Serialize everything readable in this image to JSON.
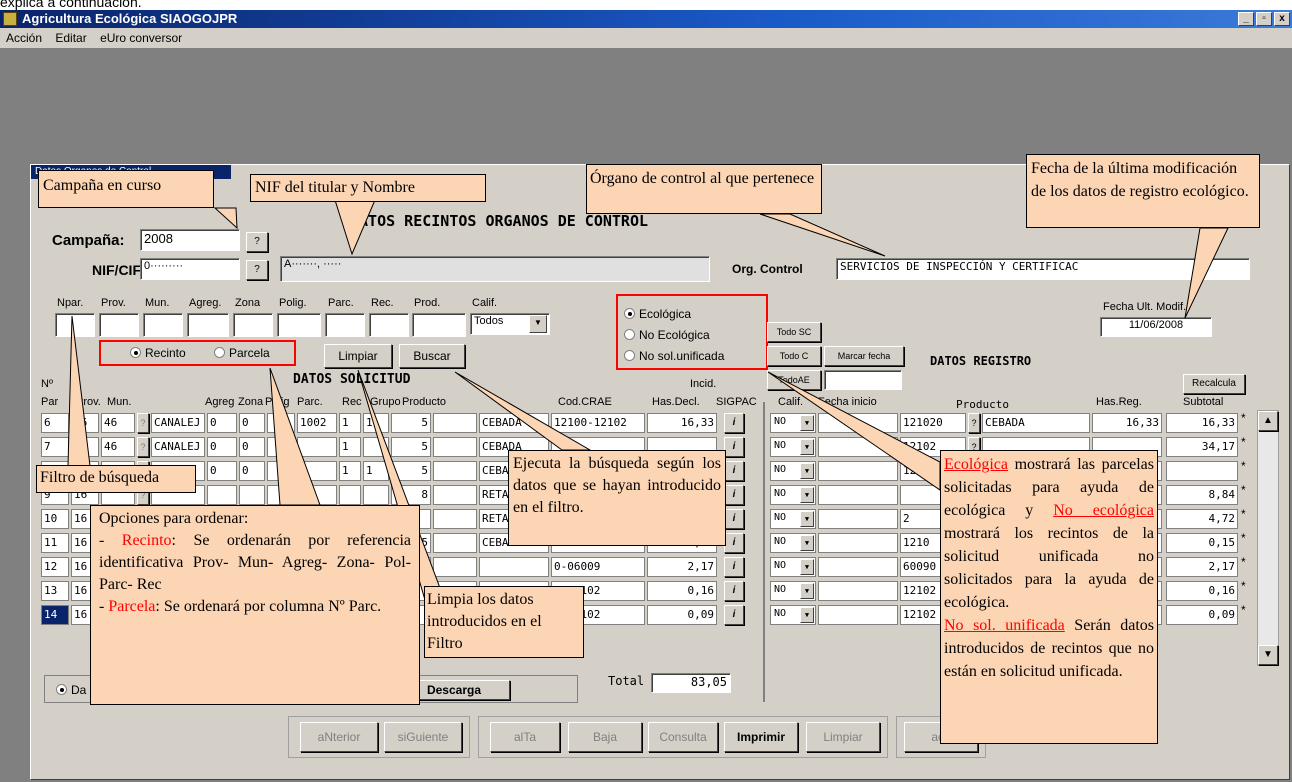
{
  "top_text": "explica a continuación.",
  "window": {
    "title": "Agricultura Ecológica   SIAOGOJPR",
    "min": "_",
    "max": "▫",
    "close": "x"
  },
  "menu": [
    "Acción",
    "Editar",
    "eUro conversor"
  ],
  "form_title": "Datos Organos de Control",
  "heading_recintos": "DATOS RECINTOS ORGANOS DE CONTROL",
  "campana": {
    "label": "Campaña:",
    "value": "2008",
    "q": "?"
  },
  "nif": {
    "label": "NIF/CIF:",
    "value": "0·········",
    "name": "A·······, ·····",
    "q": "?"
  },
  "org_control": {
    "label": "Org. Control",
    "value": "SERVICIOS DE INSPECCIÓN Y CERTIFICAC"
  },
  "filters": {
    "labels": [
      "Npar.",
      "Prov.",
      "Mun.",
      "Agreg.",
      "Zona",
      "Polig.",
      "Parc.",
      "Rec.",
      "Prod.",
      "Calif."
    ],
    "calif_value": "Todos"
  },
  "order": {
    "recinto": "Recinto",
    "parcela": "Parcela"
  },
  "buttons": {
    "limpiar": "Limpiar",
    "buscar": "Buscar",
    "todo_sc": "Todo SC",
    "todo_c": "Todo C",
    "marcar_fecha": "Marcar fecha",
    "todo_ae": "TodoAE",
    "recalcula": "Recalcula",
    "descarga": "Descarga",
    "q": "?",
    "i": "i"
  },
  "tipo": {
    "ecologica": "Ecológica",
    "no_ecologica": "No Ecológica",
    "no_sol": "No sol.unificada"
  },
  "fecha_ult": {
    "label": "Fecha Ult. Modif.",
    "value": "11/06/2008"
  },
  "heading_registro": "DATOS REGISTRO",
  "heading_solicitud": "DATOS SOLICITUD",
  "col_headers": {
    "n": "Nº",
    "par": "Par",
    "prov": "Prov.",
    "mun": "Mun.",
    "agreg": "Agreg",
    "zona": "Zona",
    "polig": "Polig",
    "parc": "Parc.",
    "rec": "Rec",
    "grupo": "Grupo",
    "producto": "Producto",
    "crae": "Cod.CRAE",
    "hasdecl": "Has.Decl.",
    "incid": "Incid.",
    "sigpac": "SIGPAC",
    "calif": "Calif.",
    "fecha_inicio": "Fecha inicio",
    "producto2": "Producto",
    "hasreg": "Has.Reg.",
    "subtotal": "Subtotal"
  },
  "rows": [
    {
      "par": "6",
      "prov": "16",
      "mun": "46",
      "name": "CANALEJ",
      "agreg": "0",
      "zona": "0",
      "polig": "",
      "parc": "1002",
      "rec": "1",
      "grupo": "1",
      "prod": "5",
      "prodname": "CEBADA",
      "crae": "12100-12102",
      "hasdecl": "16,33",
      "calif": "NO",
      "cod": "121020",
      "prod2": "CEBADA",
      "hasreg": "16,33",
      "subtotal": "16,33"
    },
    {
      "par": "7",
      "prov": "16",
      "mun": "46",
      "name": "CANALEJ",
      "agreg": "0",
      "zona": "0",
      "polig": "",
      "parc": "",
      "rec": "1",
      "grupo": "",
      "prod": "5",
      "prodname": "CEBADA",
      "crae": "",
      "hasdecl": "",
      "calif": "NO",
      "cod": "12102",
      "prod2": "",
      "hasreg": "",
      "subtotal": "34,17"
    },
    {
      "par": "8",
      "prov": "16",
      "mun": "",
      "name": "",
      "agreg": "0",
      "zona": "0",
      "polig": "",
      "parc": "",
      "rec": "1",
      "grupo": "1",
      "prod": "5",
      "prodname": "CEBADA",
      "crae": "",
      "hasdecl": "",
      "calif": "NO",
      "cod": "12102",
      "prod2": "",
      "hasreg": "",
      "subtotal": ""
    },
    {
      "par": "9",
      "prov": "16",
      "mun": "",
      "name": "",
      "agreg": "",
      "zona": "",
      "polig": "",
      "parc": "",
      "rec": "",
      "grupo": "",
      "prod": "8",
      "prodname": "RETAMA",
      "crae": "",
      "hasdecl": "",
      "calif": "NO",
      "cod": "",
      "prod2": "",
      "hasreg": "",
      "subtotal": "8,84"
    },
    {
      "par": "10",
      "prov": "16",
      "mun": "",
      "name": "",
      "agreg": "",
      "zona": "",
      "polig": "",
      "parc": "",
      "rec": "",
      "grupo": "",
      "prod": "",
      "prodname": "RETAMA",
      "crae": "",
      "hasdecl": "",
      "calif": "NO",
      "cod": "2",
      "prod2": "",
      "hasreg": "",
      "subtotal": "4,72"
    },
    {
      "par": "11",
      "prov": "16",
      "mun": "",
      "name": "",
      "agreg": "",
      "zona": "",
      "polig": "",
      "parc": "",
      "rec": "",
      "grupo": "",
      "prod": "5",
      "prodname": "CEBADA",
      "crae": "12100-12102",
      "hasdecl": "0,15",
      "calif": "NO",
      "cod": "1210",
      "prod2": "",
      "hasreg": "",
      "subtotal": "0,15"
    },
    {
      "par": "12",
      "prov": "16",
      "mun": "",
      "name": "",
      "agreg": "",
      "zona": "",
      "polig": "",
      "parc": "",
      "rec": "",
      "grupo": "",
      "prod": "",
      "prodname": "",
      "crae": "0-06009",
      "hasdecl": "2,17",
      "calif": "NO",
      "cod": "60090",
      "prod2": "",
      "hasreg": "",
      "subtotal": "2,17"
    },
    {
      "par": "13",
      "prov": "16",
      "mun": "",
      "name": "",
      "agreg": "",
      "zona": "",
      "polig": "",
      "parc": "",
      "rec": "",
      "grupo": "",
      "prod": "",
      "prodname": "",
      "crae": "0-12102",
      "hasdecl": "0,16",
      "calif": "NO",
      "cod": "12102",
      "prod2": "",
      "hasreg": "",
      "subtotal": "0,16"
    },
    {
      "par": "14",
      "prov": "16",
      "mun": "",
      "name": "",
      "agreg": "",
      "zona": "",
      "polig": "",
      "parc": "",
      "rec": "",
      "grupo": "",
      "prod": "",
      "prodname": "",
      "crae": "0-12102",
      "hasdecl": "0,09",
      "calif": "NO",
      "cod": "12102",
      "prod2": "",
      "hasreg": "",
      "subtotal": "0,09"
    }
  ],
  "total": {
    "label": "Total",
    "value": "83,05"
  },
  "datos_radio": "Da",
  "star": "*",
  "nav_buttons": [
    "aNterior",
    "siGuiente",
    "alTa",
    "Baja",
    "Consulta",
    "Imprimir",
    "Limpiar",
    "ace"
  ],
  "callouts": {
    "campana": "Campaña en  curso",
    "nif": "NIF del titular y Nombre",
    "organo": "Órgano de control al que pertenece",
    "fecha": "Fecha   de   la   última modificación de los datos de registro ecológico.",
    "filtro": "Filtro de búsqueda",
    "ejecuta": "Ejecuta la búsqueda según los datos que se hayan introducido en el filtro.",
    "limpia": "Limpia los datos introducidos en el Filtro",
    "opciones_title": "Opciones para ordenar:",
    "opciones_recinto_label": "Recinto",
    "opciones_recinto_text": ": Se ordenarán por referencia identificativa Prov- Mun- Agreg- Zona- Pol- Parc- Rec",
    "opciones_parcela_label": "Parcela",
    "opciones_parcela_text": ": Se ordenará por columna Nº Parc.",
    "eco_label": "Ecológica",
    "eco_text": " mostrará las parcelas solicitadas para ayuda de ecológica y ",
    "noeco_label": "No ecológica",
    "noeco_text": " mostrará los recintos de la solicitud unificada no solicitados para la ayuda de ecológica.",
    "nosol_label": "No sol. unificada",
    "nosol_text": " Serán datos introducidos de recintos que no están en solicitud unificada."
  },
  "colors": {
    "callout": "#fcd5b4",
    "red": "#ff0000",
    "titlebar": "#0a246a",
    "panel": "#d4d0c8"
  }
}
